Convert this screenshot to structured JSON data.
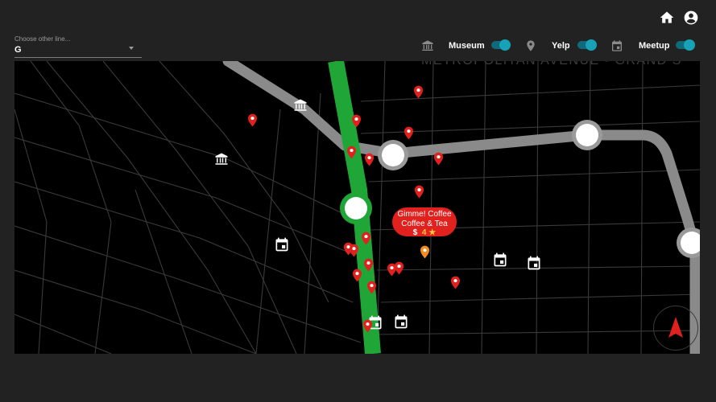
{
  "header": {
    "home_icon": "home-icon",
    "account_icon": "account-circle-icon"
  },
  "line_select": {
    "label": "Choose other line...",
    "value": "G"
  },
  "toggles": [
    {
      "label": "Museum",
      "icon": "museum-icon",
      "on": true
    },
    {
      "label": "Yelp",
      "icon": "map-pin-icon",
      "on": true
    },
    {
      "label": "Meetup",
      "icon": "calendar-icon",
      "on": true
    }
  ],
  "map": {
    "street_label": "METROPOLITAN AVENUE - GRAND S",
    "popup": {
      "name": "Gimme! Coffee",
      "category": "Coffee & Tea",
      "price": "$",
      "rating": "4 ★"
    },
    "colors": {
      "g_line": "#1fa637",
      "other_line": "#8a8a8a",
      "yelp_pin": "#e0211d",
      "selected_pin": "#f28c1f",
      "background": "#000000",
      "streets": "#3a3a3a"
    }
  }
}
